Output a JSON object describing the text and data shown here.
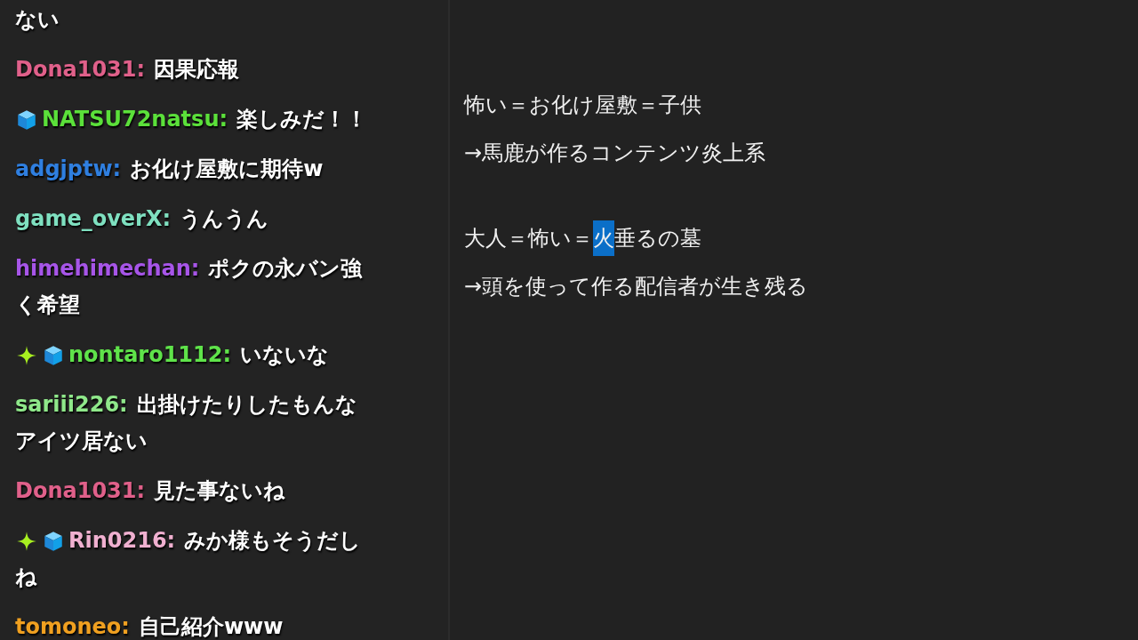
{
  "chat": {
    "messages": [
      {
        "continued": "ない"
      },
      {
        "username": "Dona1031:",
        "color": "#e0608a",
        "text": "因果応報"
      },
      {
        "badges": [
          {
            "kind": "cube"
          }
        ],
        "username": "NATSU72natsu:",
        "color": "#5be03a",
        "text": "楽しみだ！！"
      },
      {
        "username": "adgjptw:",
        "color": "#2f7fe0",
        "text": "お化け屋敷に期待w"
      },
      {
        "username": "game_overX:",
        "color": "#7fe0c0",
        "text": "うんうん"
      },
      {
        "username": "himehimechan:",
        "color": "#a755e8",
        "text": "ポクの永バン強",
        "continued": "く希望"
      },
      {
        "badges": [
          {
            "kind": "sparkle"
          },
          {
            "kind": "cube"
          }
        ],
        "username": "nontaro1112:",
        "color": "#5fe34a",
        "text": "いないな"
      },
      {
        "username": "sariii226:",
        "color": "#8fe88a",
        "text": "出掛けたりしたもんな",
        "continued": "アイツ居ない"
      },
      {
        "username": "Dona1031:",
        "color": "#e0608a",
        "text": "見た事ないね"
      },
      {
        "badges": [
          {
            "kind": "sparkle"
          },
          {
            "kind": "cube"
          }
        ],
        "username": "Rin0216:",
        "color": "#f0b0d0",
        "text": "みか様もそうだし",
        "continued": "ね"
      },
      {
        "username": "tomoneo:",
        "color": "#f0a020",
        "text": "自己紹介www"
      }
    ]
  },
  "editor": {
    "paragraphs": [
      [
        {
          "segments": [
            {
              "text": "怖い＝お化け屋敷＝子供",
              "selected": false
            }
          ]
        },
        {
          "segments": [
            {
              "text": "→馬鹿が作るコンテンツ炎上系",
              "selected": false
            }
          ]
        }
      ],
      [
        {
          "segments": [
            {
              "text": "大人＝怖い＝",
              "selected": false
            },
            {
              "text": "火",
              "selected": true
            },
            {
              "text": "垂るの墓",
              "selected": false
            }
          ]
        },
        {
          "segments": [
            {
              "text": "→頭を使って作る配信者が生き残る",
              "selected": false
            }
          ]
        }
      ]
    ]
  }
}
